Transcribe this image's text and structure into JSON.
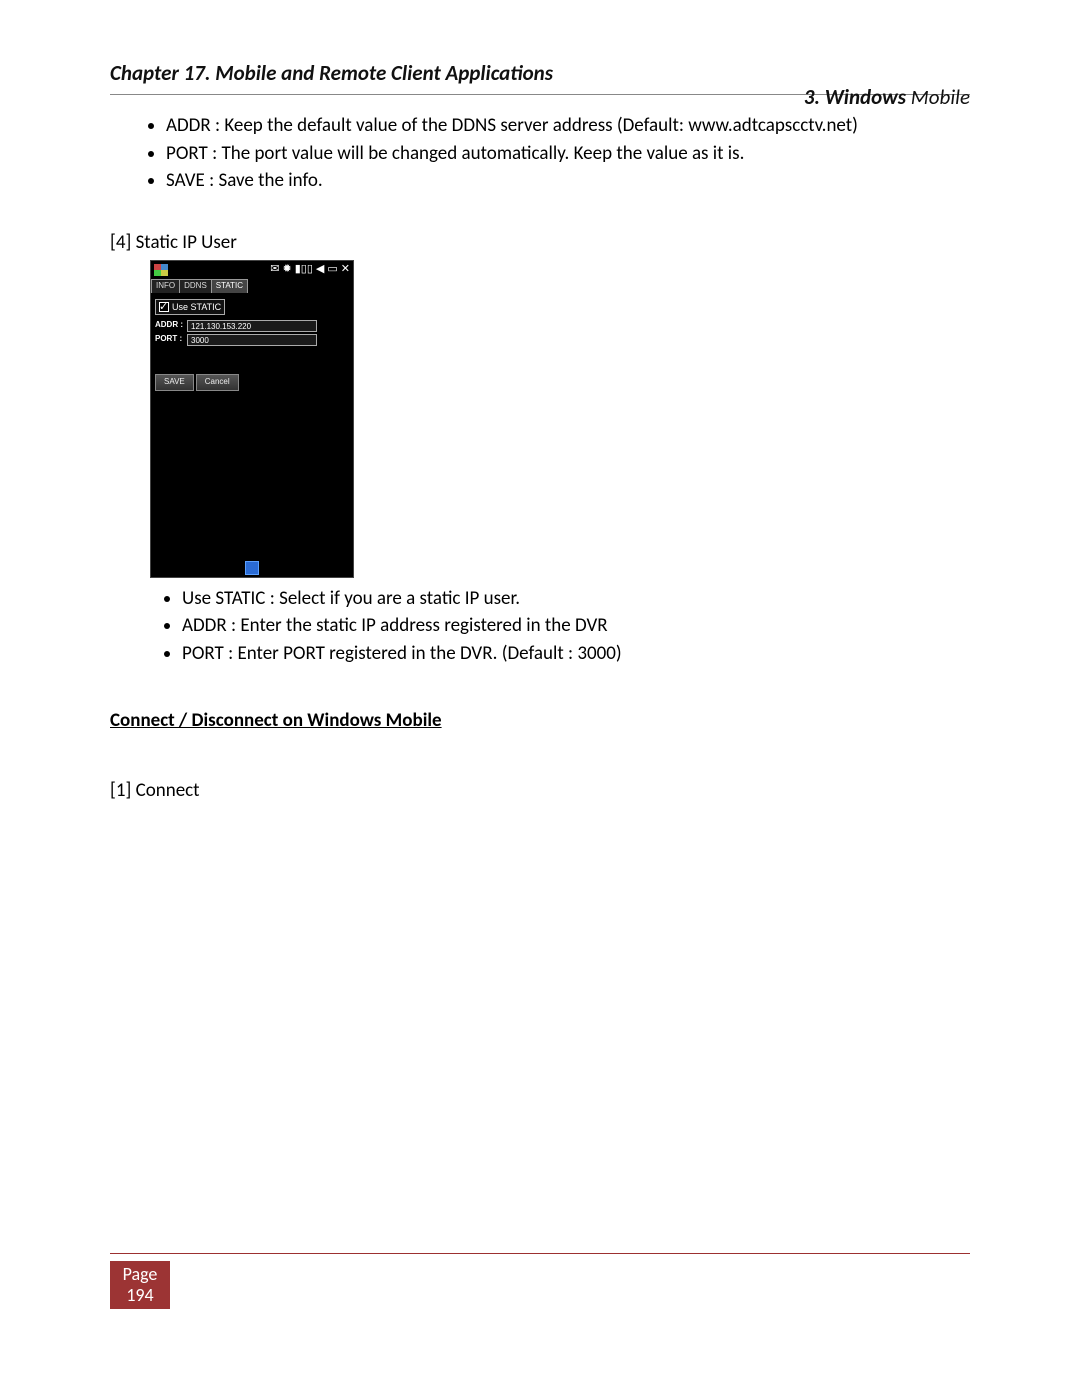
{
  "header": {
    "chapter": "Chapter 17. Mobile and Remote Client Applications",
    "section_prefix": "3. Windows",
    "section_suffix": " Mobile"
  },
  "bullets_top": [
    "ADDR : Keep the default value of the DDNS server address (Default: www.adtcapscctv.net)",
    "PORT : The port value will be changed automatically. Keep the value as it is.",
    "SAVE : Save the info."
  ],
  "step4_label": "[4] Static IP User",
  "screenshot": {
    "tabs": [
      "INFO",
      "DDNS",
      "STATIC"
    ],
    "active_tab": 2,
    "checkbox_label": "Use STATIC",
    "fields": {
      "addr_label": "ADDR :",
      "addr_value": "121.130.153.220",
      "port_label": "PORT :",
      "port_value": "3000"
    },
    "buttons": {
      "save": "SAVE",
      "cancel": "Cancel"
    }
  },
  "bullets_lower": [
    "Use STATIC : Select if you are a static IP user.",
    "ADDR : Enter the static IP address registered in the DVR",
    "PORT : Enter PORT registered in the DVR. (Default : 3000)"
  ],
  "subheading": "Connect / Disconnect on Windows Mobile",
  "connect_label": "[1] Connect",
  "footer": {
    "page_word": "Page",
    "page_number": "194"
  }
}
